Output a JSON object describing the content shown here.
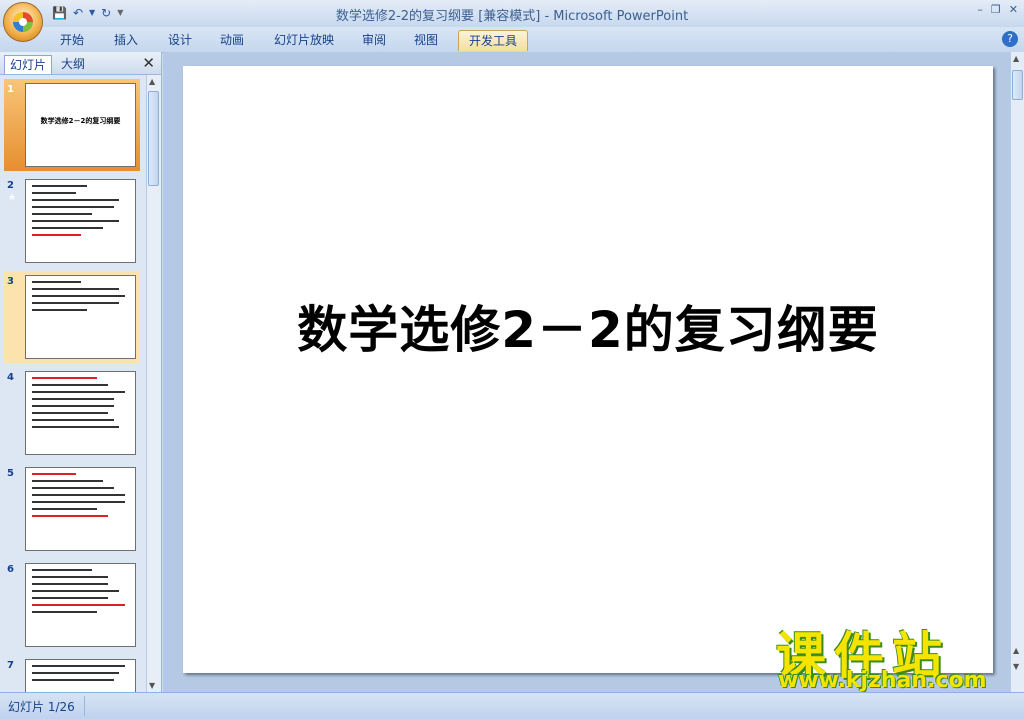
{
  "app": {
    "title": "数学选修2-2的复习纲要 [兼容模式] - Microsoft PowerPoint"
  },
  "quick_access": {
    "save_icon": "save-icon",
    "undo_icon": "undo-icon",
    "redo_icon": "redo-icon"
  },
  "ribbon": {
    "tabs": [
      {
        "label": "开始"
      },
      {
        "label": "插入"
      },
      {
        "label": "设计"
      },
      {
        "label": "动画"
      },
      {
        "label": "幻灯片放映"
      },
      {
        "label": "审阅"
      },
      {
        "label": "视图"
      },
      {
        "label": "开发工具",
        "active": true
      }
    ]
  },
  "left_pane": {
    "tabs": [
      {
        "label": "幻灯片"
      },
      {
        "label": "大纲"
      }
    ],
    "close_icon": "close-icon",
    "slides": [
      {
        "number": "1",
        "title": "数学选修2－2的复习纲要"
      },
      {
        "number": "2"
      },
      {
        "number": "3"
      },
      {
        "number": "4"
      },
      {
        "number": "5"
      },
      {
        "number": "6"
      },
      {
        "number": "7"
      }
    ]
  },
  "editor": {
    "slide_title": "数学选修2－2的复习纲要"
  },
  "watermark": {
    "text": "课件站",
    "url": "www.kjzhan.com"
  },
  "status": {
    "slide_counter": "幻灯片 1/26"
  }
}
